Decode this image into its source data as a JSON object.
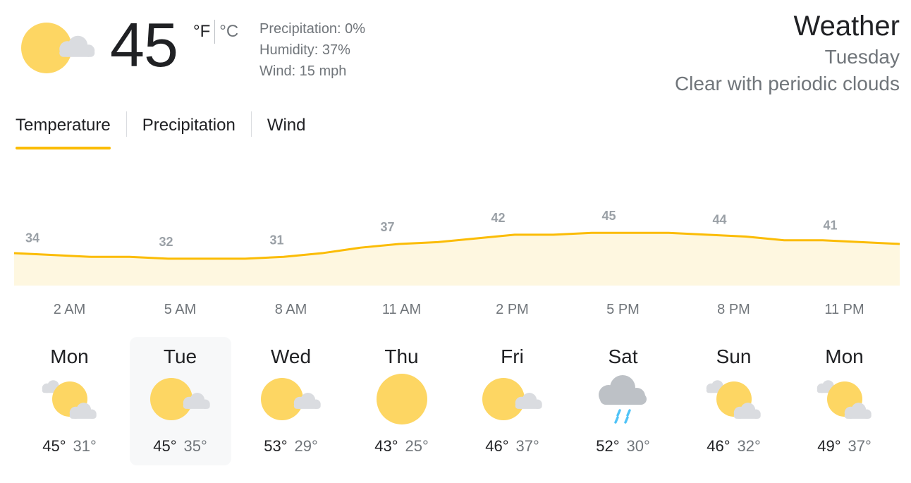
{
  "current": {
    "icon": "partly-sunny-icon",
    "temperature": "45",
    "unit_f": "°F",
    "unit_c": "°C",
    "precipitation": "Precipitation: 0%",
    "humidity": "Humidity: 37%",
    "wind": "Wind: 15 mph"
  },
  "header": {
    "title": "Weather",
    "day": "Tuesday",
    "condition": "Clear with periodic clouds"
  },
  "tabs": [
    {
      "label": "Temperature",
      "active": true
    },
    {
      "label": "Precipitation",
      "active": false
    },
    {
      "label": "Wind",
      "active": false
    }
  ],
  "chart_data": {
    "type": "area",
    "x": [
      "2 AM",
      "5 AM",
      "8 AM",
      "11 AM",
      "2 PM",
      "5 PM",
      "8 PM",
      "11 PM"
    ],
    "values": [
      34,
      32,
      31,
      37,
      42,
      45,
      44,
      41
    ],
    "curve": [
      34,
      33,
      32,
      32,
      31,
      31,
      31,
      32,
      34,
      37,
      39,
      40,
      42,
      44,
      44,
      45,
      45,
      45,
      44,
      43,
      41,
      41,
      40,
      39
    ],
    "line_color": "#fbbc04",
    "fill_color": "#fef7e0"
  },
  "forecast": [
    {
      "day": "Mon",
      "icon": "mostly-cloudy-sun-icon",
      "high": "45°",
      "low": "31°",
      "selected": false
    },
    {
      "day": "Tue",
      "icon": "partly-sunny-icon",
      "high": "45°",
      "low": "35°",
      "selected": true
    },
    {
      "day": "Wed",
      "icon": "partly-sunny-icon",
      "high": "53°",
      "low": "29°",
      "selected": false
    },
    {
      "day": "Thu",
      "icon": "sunny-icon",
      "high": "43°",
      "low": "25°",
      "selected": false
    },
    {
      "day": "Fri",
      "icon": "partly-sunny-icon",
      "high": "46°",
      "low": "37°",
      "selected": false
    },
    {
      "day": "Sat",
      "icon": "rain-icon",
      "high": "52°",
      "low": "30°",
      "selected": false
    },
    {
      "day": "Sun",
      "icon": "mostly-cloudy-sun-icon",
      "high": "46°",
      "low": "32°",
      "selected": false
    },
    {
      "day": "Mon",
      "icon": "mostly-cloudy-sun-icon",
      "high": "49°",
      "low": "37°",
      "selected": false
    }
  ],
  "colors": {
    "sun": "#fdd663",
    "cloud": "#dadce0",
    "rain": "#4fc3f7",
    "accent": "#fbbc04"
  }
}
